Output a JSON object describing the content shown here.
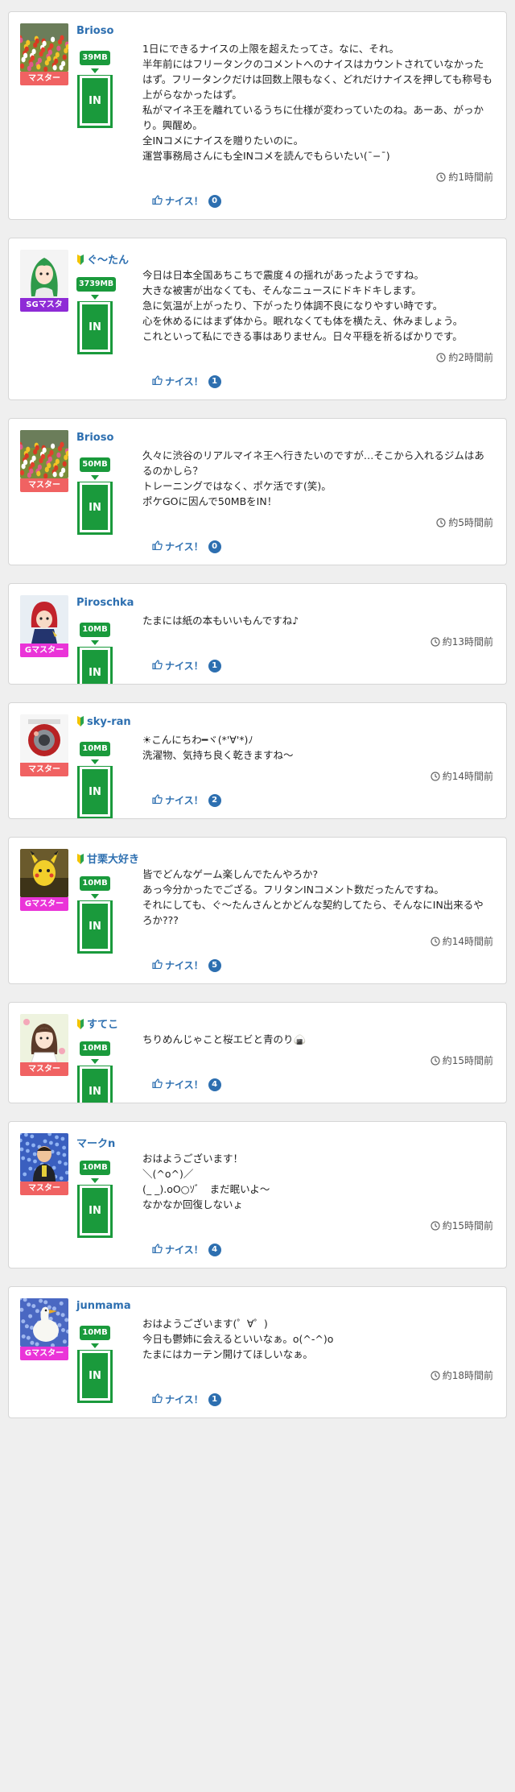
{
  "colors": {
    "accent_green": "#1a9a3c",
    "link_blue": "#2d6fb0",
    "rank_master": "#f06262",
    "rank_sg_master": "#8e2bd6",
    "rank_g_master": "#ea34d8"
  },
  "like_label": "ナイス！",
  "in_label": "IN",
  "posts": [
    {
      "user": "Brioso",
      "beginner": false,
      "avatar": "tulip-field",
      "rank": "マスター",
      "rank_color": "#f06262",
      "mb": "39MB",
      "text": "1日にできるナイスの上限を超えたってさ。なに、それ。\n半年前にはフリータンクのコメントへのナイスはカウントされていなかったはず。フリータンクだけは回数上限もなく、どれだけナイスを押しても称号も上がらなかったはず。\n私がマイネ王を離れているうちに仕様が変わっていたのね。あーあ、がっかり。興醒め。\n全INコメにナイスを贈りたいのに。\n運営事務局さんにも全INコメを読んでもらいたい(¯−¯)",
      "time": "約1時間前",
      "likes": "0"
    },
    {
      "user": "ぐ〜たん",
      "beginner": true,
      "avatar": "green-hair-girl",
      "rank": "SGマスタ",
      "rank_color": "#8e2bd6",
      "mb": "3739MB",
      "text": "今日は日本全国あちこちで震度４の揺れがあったようですね。\n大きな被害が出なくても、そんなニュースにドキドキします。\n急に気温が上がったり、下がったり体調不良になりやすい時です。\n心を休めるにはまず体から。眠れなくても体を横たえ、休みましょう。\nこれといって私にできる事はありません。日々平穏を祈るばかりです。",
      "time": "約2時間前",
      "likes": "1"
    },
    {
      "user": "Brioso",
      "beginner": false,
      "avatar": "tulip-field",
      "rank": "マスター",
      "rank_color": "#f06262",
      "mb": "50MB",
      "text": "久々に渋谷のリアルマイネ王へ行きたいのですが…そこから入れるジムはあるのかしら？\nトレーニングではなく、ポケ活です(笑)。\nポケGOに因んで50MBをIN！",
      "time": "約5時間前",
      "likes": "0"
    },
    {
      "user": "Piroschka",
      "beginner": false,
      "avatar": "red-hood-character",
      "rank": "Gマスター",
      "rank_color": "#ea34d8",
      "mb": "10MB",
      "text": "たまには紙の本もいいもんですね♪",
      "time": "約13時間前",
      "likes": "1"
    },
    {
      "user": "sky-ran",
      "beginner": true,
      "avatar": "red-ornament",
      "rank": "マスター",
      "rank_color": "#f06262",
      "mb": "10MB",
      "text": "☀こんにちわ━ヾ(*'∀'*)ﾉ\n洗濯物、気持ち良く乾きますね〜",
      "time": "約14時間前",
      "likes": "2"
    },
    {
      "user": "甘栗大好き",
      "beginner": true,
      "avatar": "pikachu-figure",
      "rank": "Gマスター",
      "rank_color": "#ea34d8",
      "mb": "10MB",
      "text": "皆でどんなゲーム楽しんでたんやろか?\nあっ今分かったでござる。フリタンINコメント数だったんですね。\nそれにしても、ぐ〜たんさんとかどんな契約してたら、そんなにIN出来るやろか???",
      "time": "約14時間前",
      "likes": "5"
    },
    {
      "user": "すてこ",
      "beginner": true,
      "avatar": "girl-illustration",
      "rank": "マスター",
      "rank_color": "#f06262",
      "mb": "10MB",
      "text": "ちりめんじゃこと桜エビと青のり🍙",
      "time": "約15時間前",
      "likes": "4"
    },
    {
      "user": "マークn",
      "beginner": false,
      "avatar": "man-with-flowers",
      "rank": "マスター",
      "rank_color": "#f06262",
      "mb": "10MB",
      "text": "おはようございます！\n＼(^o^)／\n(_ _).oO○ｿﾞ　まだ眠いよ〜\nなかなか回復しないょ",
      "time": "約15時間前",
      "likes": "4"
    },
    {
      "user": "junmama",
      "beginner": false,
      "avatar": "white-bird",
      "rank": "Gマスター",
      "rank_color": "#ea34d8",
      "mb": "10MB",
      "text": "おはようございます(゜∀゜)\n今日も鬱姉に会えるといいなぁ。o(^-^)o\nたまにはカーテン開けてほしいなぁ。",
      "time": "約18時間前",
      "likes": "1"
    }
  ]
}
